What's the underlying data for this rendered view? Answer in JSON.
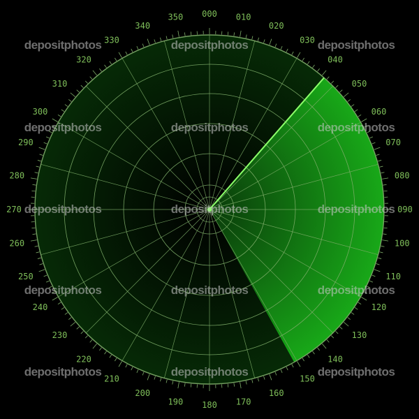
{
  "radar": {
    "bearing_labels": [
      "000",
      "010",
      "020",
      "030",
      "040",
      "050",
      "060",
      "070",
      "080",
      "090",
      "100",
      "110",
      "120",
      "130",
      "140",
      "150",
      "160",
      "170",
      "180",
      "190",
      "200",
      "210",
      "220",
      "230",
      "240",
      "250",
      "260",
      "270",
      "280",
      "290",
      "300",
      "310",
      "320",
      "330",
      "340",
      "350"
    ],
    "sweep_bearing_deg": 41,
    "sweep_trail_deg": 110,
    "ring_count": 6,
    "spoke_count": 24
  },
  "watermark": {
    "text": "depositphotos"
  },
  "colors": {
    "background": "#000000",
    "grid": "#7fae6a",
    "sweep": "#19c419",
    "labels": "#7fbf5a"
  }
}
